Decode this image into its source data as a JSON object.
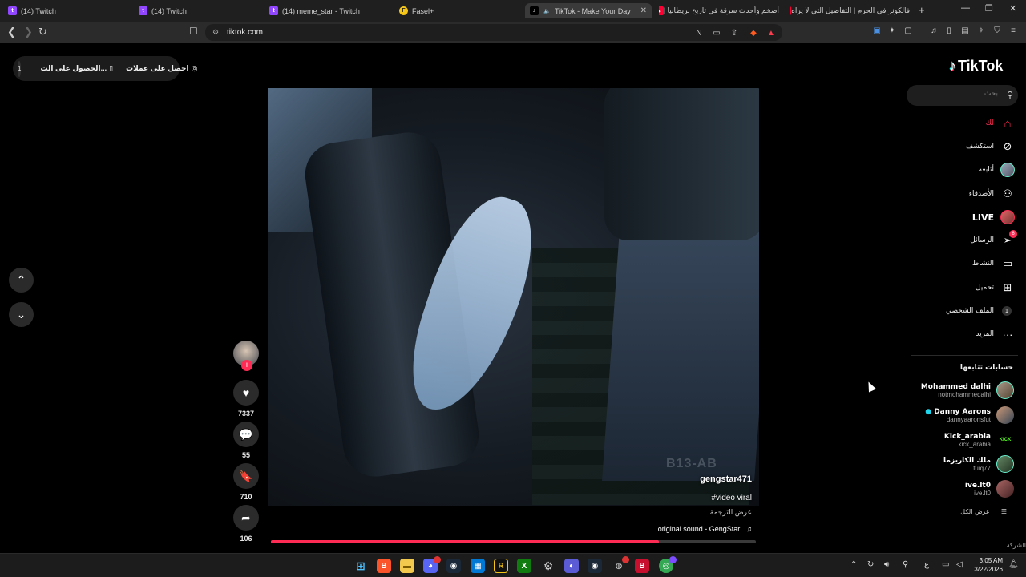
{
  "browser": {
    "tabs": [
      {
        "label": "(14) Twitch",
        "icon": "twitch-icon"
      },
      {
        "label": "(14) Twitch",
        "icon": "twitch-icon"
      },
      {
        "label": "(14) meme_star - Twitch",
        "icon": "twitch-icon"
      },
      {
        "label": "Fasel+",
        "icon": "fasel-icon"
      },
      {
        "label": "TikTok - Make Your Day",
        "icon": "tiktok-icon",
        "active": true
      },
      {
        "label": "أضخم وأحدث سرقة في تاريخ بريطانيا |",
        "icon": "youtube-icon"
      },
      {
        "label": "فالكونز في الحرم | التفاصيل التي لا يراه",
        "icon": "youtube-icon"
      }
    ],
    "url": "tiktok.com"
  },
  "promo": {
    "get_coins": "احصل على عملات",
    "get_app": "الحصول على الت...",
    "notice_count": "1"
  },
  "video": {
    "author": "gengstar471",
    "caption": "#video viral",
    "translate_label": "عرض الترجمة",
    "sound": "original sound - GengStar",
    "watermark": "B13-AB",
    "progress": 0.8
  },
  "actions": {
    "likes": "7337",
    "comments": "55",
    "saves": "710",
    "shares": "106"
  },
  "sidebar": {
    "logo": "TikTok",
    "search_placeholder": "بحث",
    "nav": [
      {
        "label": "لك",
        "icon": "home-icon"
      },
      {
        "label": "استكشف",
        "icon": "compass-icon"
      },
      {
        "label": "أتابعه",
        "icon": "following-avatar-icon"
      },
      {
        "label": "الأصدقاء",
        "icon": "friends-icon"
      },
      {
        "label": "LIVE",
        "icon": "live-icon"
      },
      {
        "label": "الرسائل",
        "icon": "messages-icon",
        "badge": "6"
      },
      {
        "label": "النشاط",
        "icon": "activity-icon"
      },
      {
        "label": "تحميل",
        "icon": "upload-icon"
      },
      {
        "label": "الملف الشخصي",
        "icon": "profile-icon",
        "badge": "1"
      },
      {
        "label": "المزيد",
        "icon": "more-icon"
      }
    ],
    "following_title": "حسابات تتابعها",
    "accounts": [
      {
        "name": "Mohammed dalhi",
        "handle": "notmohammedalhi"
      },
      {
        "name": "Danny Aarons",
        "handle": "dannyaaronsfut"
      },
      {
        "name": "Kick_arabia",
        "handle": "kick_arabia"
      },
      {
        "name": "ملك الكاريزما",
        "handle": "tuiq77"
      },
      {
        "name": "ive.lt0",
        "handle": "ive.lt0"
      }
    ],
    "see_all": "عرض الكل",
    "footer_cut": "الشركة"
  },
  "taskbar": {
    "time": "3:05 AM",
    "date": "3/22/2026",
    "language": "ع"
  },
  "colors": {
    "accent": "#fe2c55",
    "background": "#000000"
  }
}
